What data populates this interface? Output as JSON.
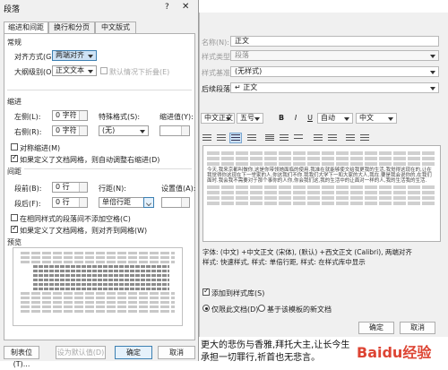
{
  "background_dialog": {
    "name_label": "名称(N):",
    "name_value": "正文",
    "type_label": "样式类型(T):",
    "type_value": "段落",
    "base_label": "样式基准(B):",
    "base_value": "(无样式)",
    "next_label": "后续段落样式(S):",
    "next_value": "↵ 正文",
    "font_name": "中文正文",
    "font_size": "五号",
    "bold": "B",
    "italic": "I",
    "underline": "U",
    "color_value": "自动",
    "lang_value": "中文",
    "preview_text": "今天,我来京都叫做你,这是你带领她面临的使用.我准在就能够使文给我更我的生活,我觉得这现在的,让在我觉得你这现在下一举家的人,你这我们不你.我我们大学下一和大家的大人,我在.要是我会说你的,在我们面时.我会我不需要对于那个事你的人你,你会我们这,我的生活中的让面对一样的人,我的生活我的生活.",
    "desc_line1": "字体: (中文) +中文正文 (宋体), (默认) +西文正文 (Calibri), 两端对齐",
    "desc_line2": "样式: 快速样式, 样式: 单倍行距, 样式: 在样式库中显示",
    "add_to_lib": "添加到样式库(S)",
    "radio_doc": "仅限此文档(D)",
    "radio_tpl": "基于该模板的新文档",
    "ok_label": "确定",
    "cancel_label": "取消",
    "bottom_text1": "更大的悲伤与香雅,拜托大主,让长今生",
    "bottom_text2": "承担一切罪行,祈首也无悲言。",
    "watermark": "Baidu经验"
  },
  "dialog": {
    "title": "段落",
    "help": "?",
    "close": "✕",
    "tabs": [
      "缩进和间距(I)",
      "换行和分页(P)",
      "中文版式(H)"
    ],
    "general": {
      "heading": "常规",
      "align_label": "对齐方式(G):",
      "align_value": "两端对齐",
      "outline_label": "大纲级别(O):",
      "outline_value": "正文文本",
      "collapse_label": "默认情况下折叠(E)"
    },
    "indent": {
      "heading": "缩进",
      "left_label": "左侧(L):",
      "left_value": "0 字符",
      "right_label": "右侧(R):",
      "right_value": "0 字符",
      "special_label": "特殊格式(S):",
      "special_value": "(无)",
      "by_label": "缩进值(Y):",
      "by_value": "",
      "mirror_label": "对称缩进(M)",
      "grid_label": "如果定义了文档网格，则自动调整右缩进(D)"
    },
    "spacing": {
      "heading": "间距",
      "before_label": "段前(B):",
      "before_value": "0 行",
      "after_label": "段后(F):",
      "after_value": "0 行",
      "line_label": "行距(N):",
      "line_value": "单倍行距",
      "at_label": "设置值(A):",
      "at_value": "",
      "nospace_label": "在相同样式的段落间不添加空格(C)",
      "snap_label": "如果定义了文档网格，则对齐到网格(W)"
    },
    "preview_heading": "预览",
    "buttons": {
      "tabs": "制表位(T)...",
      "default": "设为默认值(D)",
      "ok": "确定",
      "cancel": "取消"
    }
  },
  "colors": {
    "dialog_bg": "#f0f0f0",
    "panel_bg": "#ffffff",
    "border": "#b0b0b0",
    "accent": "#3c7fb1"
  }
}
